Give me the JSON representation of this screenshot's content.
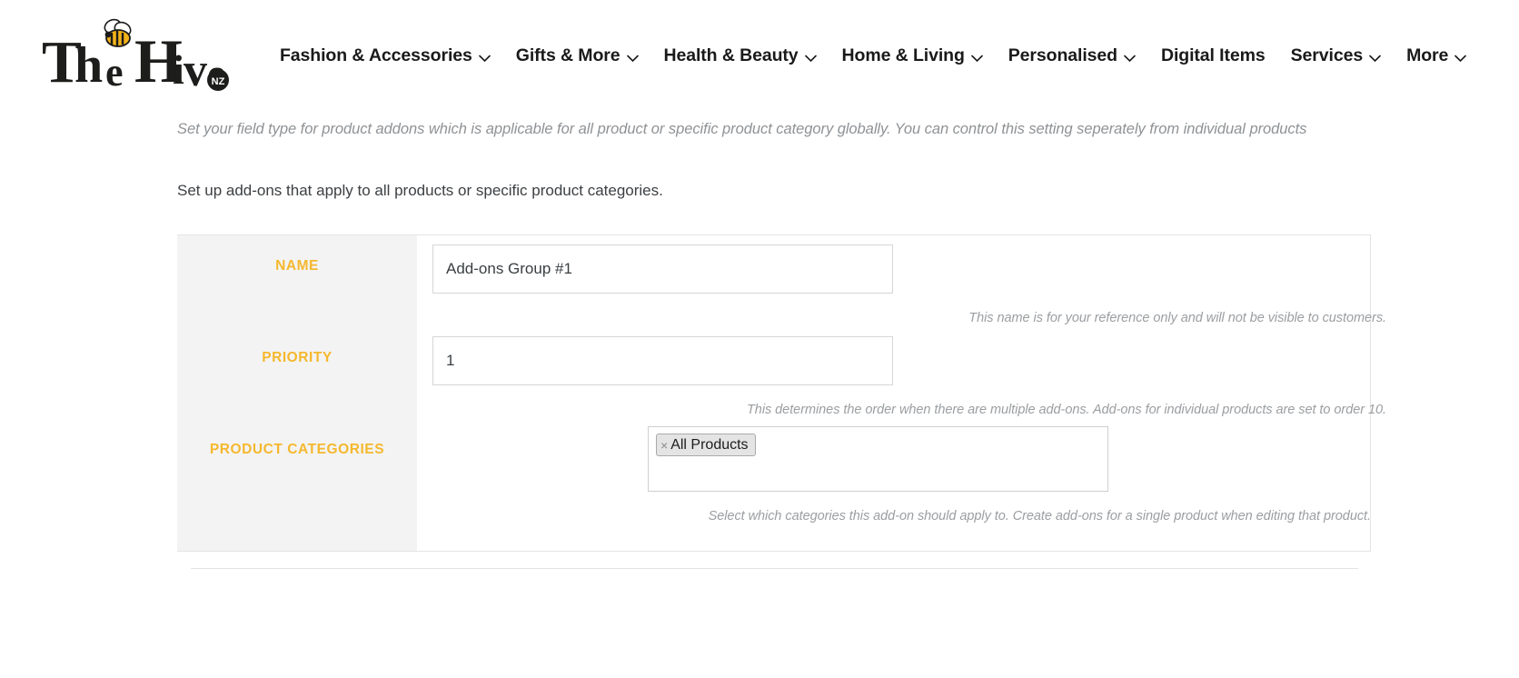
{
  "header": {
    "logo": {
      "text": "The Hive",
      "badge": "NZ",
      "icon": "bee-icon"
    },
    "nav": [
      {
        "label": "Fashion & Accessories",
        "has_dropdown": true
      },
      {
        "label": "Gifts & More",
        "has_dropdown": true
      },
      {
        "label": "Health & Beauty",
        "has_dropdown": true
      },
      {
        "label": "Home & Living",
        "has_dropdown": true
      },
      {
        "label": "Personalised",
        "has_dropdown": true
      },
      {
        "label": "Digital Items",
        "has_dropdown": false
      },
      {
        "label": "Services",
        "has_dropdown": true
      },
      {
        "label": "More",
        "has_dropdown": true
      }
    ]
  },
  "main": {
    "note": "Set your field type for product addons which is applicable for all product or specific product category globally. You can control this setting seperately from individual products",
    "description": "Set up add-ons that apply to all products or specific product categories.",
    "fields": {
      "name": {
        "label": "NAME",
        "value": "Add-ons Group #1",
        "placeholder": "",
        "helper": "This name is for your reference only and will not be visible to customers."
      },
      "priority": {
        "label": "PRIORITY",
        "value": "1",
        "placeholder": "",
        "helper": "This determines the order when there are multiple add-ons. Add-ons for individual products are set to order 10."
      },
      "product_categories": {
        "label": "PRODUCT CATEGORIES",
        "tags": [
          {
            "label": "All Products",
            "remove": "×"
          }
        ],
        "helper": "Select which categories this add-on should apply to. Create add-ons for a single product when editing that product."
      }
    }
  },
  "colors": {
    "label_accent": "#f5b82e",
    "panel_bg": "#f3f3f3",
    "border": "#e4e4e4",
    "helper_text": "#9b9ea1"
  }
}
